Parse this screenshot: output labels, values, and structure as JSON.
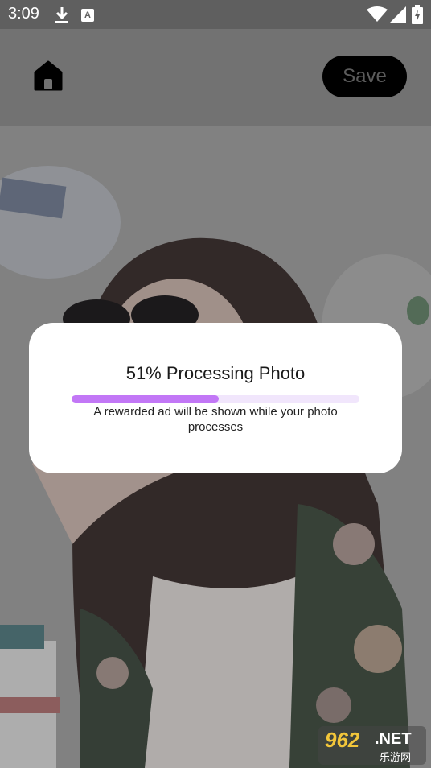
{
  "status_bar": {
    "time": "3:09",
    "icons": [
      "download-icon",
      "a-notification-icon",
      "wifi-icon",
      "signal-icon",
      "battery-charging-icon"
    ],
    "a_icon_label": "A"
  },
  "toolbar": {
    "home_icon": "home-icon",
    "save_label": "Save"
  },
  "dialog": {
    "title": "51% Processing Photo",
    "progress": 0.51,
    "message": "A rewarded ad will be shown while your photo processes",
    "colors": {
      "fill": "#c277f6",
      "track": "#f1e6fc"
    }
  },
  "watermark": {
    "number": "962",
    "suffix": ".NET",
    "chinese": "乐游网"
  }
}
